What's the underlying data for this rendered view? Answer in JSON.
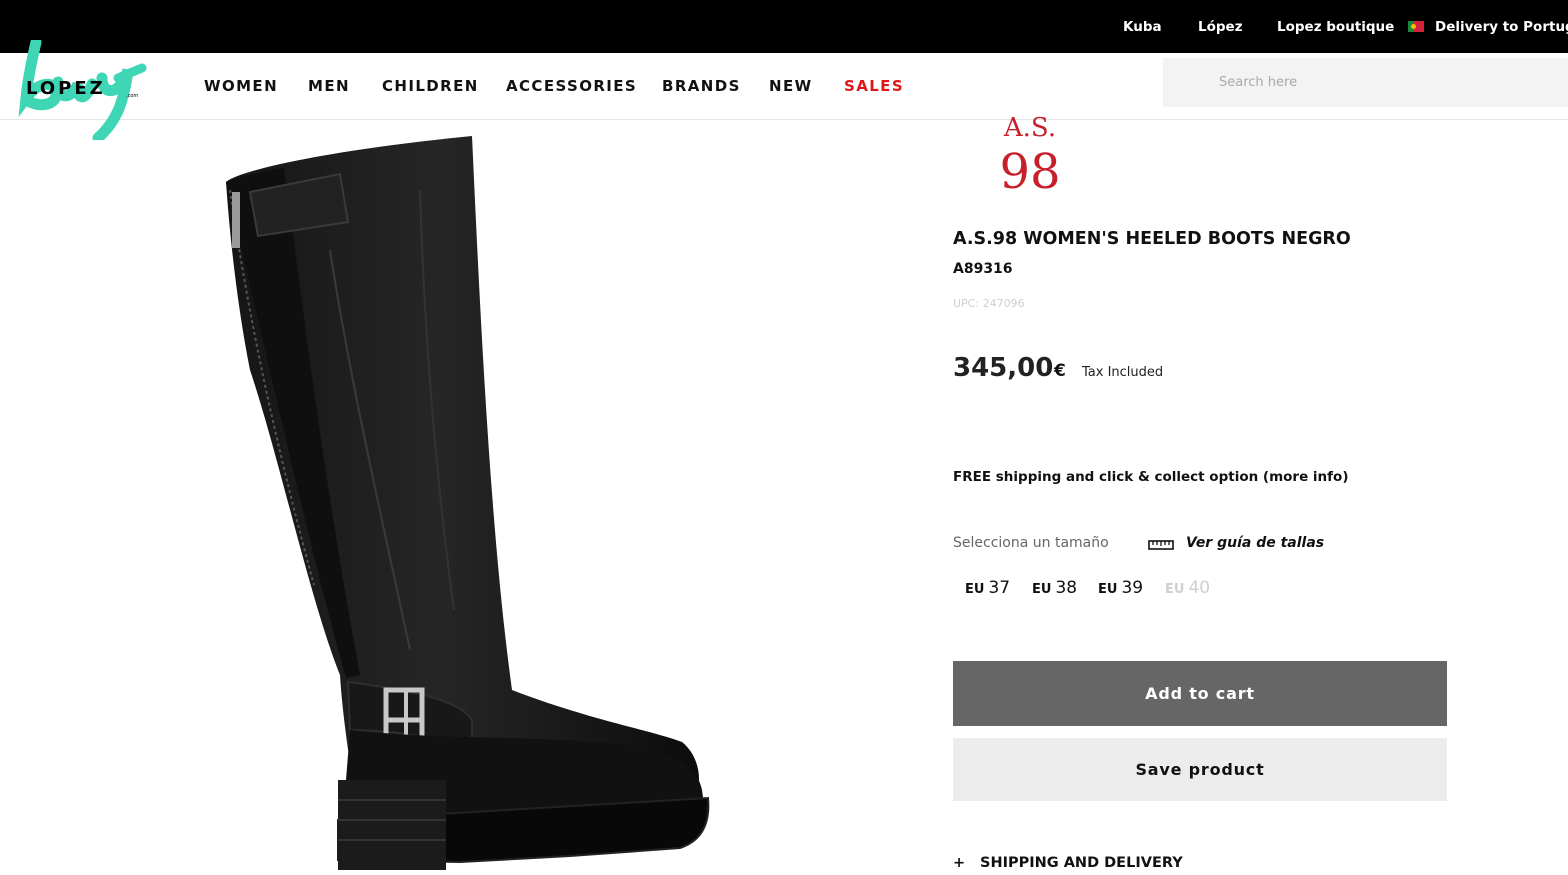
{
  "topbar": {
    "links": [
      "Kuba",
      "López",
      "Lopez boutique"
    ],
    "delivery_label": "Delivery to Portugal",
    "flag_icon": "portugal-flag-icon"
  },
  "logo": {
    "script_text": "buy",
    "wordmark": "LOPEZ",
    "suffix": ".com",
    "accent_color": "#3ed6b4"
  },
  "nav": {
    "items": [
      "WOMEN",
      "MEN",
      "CHILDREN",
      "ACCESSORIES",
      "BRANDS",
      "NEW",
      "SALES"
    ],
    "sales_color": "#e0161b"
  },
  "search": {
    "placeholder": "Search here",
    "value": ""
  },
  "brand": {
    "logo_line1": "A.S.",
    "logo_line2": "98",
    "color": "#c8202b"
  },
  "product": {
    "title": "A.S.98 WOMEN'S HEELED BOOTS NEGRO",
    "reference": "A89316",
    "upc": "UPC: 247096",
    "price": "345,00",
    "currency": "€",
    "tax_note": "Tax Included",
    "shipping_note": "FREE shipping and click & collect option (more info)",
    "image": "black-knee-high-leather-boot"
  },
  "sizes": {
    "label": "Selecciona un tamaño",
    "guide_label": "Ver guía de tallas",
    "guide_icon": "ruler-icon",
    "options": [
      {
        "prefix": "EU",
        "value": "37",
        "available": true
      },
      {
        "prefix": "EU",
        "value": "38",
        "available": true
      },
      {
        "prefix": "EU",
        "value": "39",
        "available": true
      },
      {
        "prefix": "EU",
        "value": "40",
        "available": false
      }
    ]
  },
  "actions": {
    "add_to_cart": "Add to cart",
    "save_product": "Save product"
  },
  "accordion": {
    "icon": "+",
    "label": "SHIPPING AND DELIVERY"
  }
}
